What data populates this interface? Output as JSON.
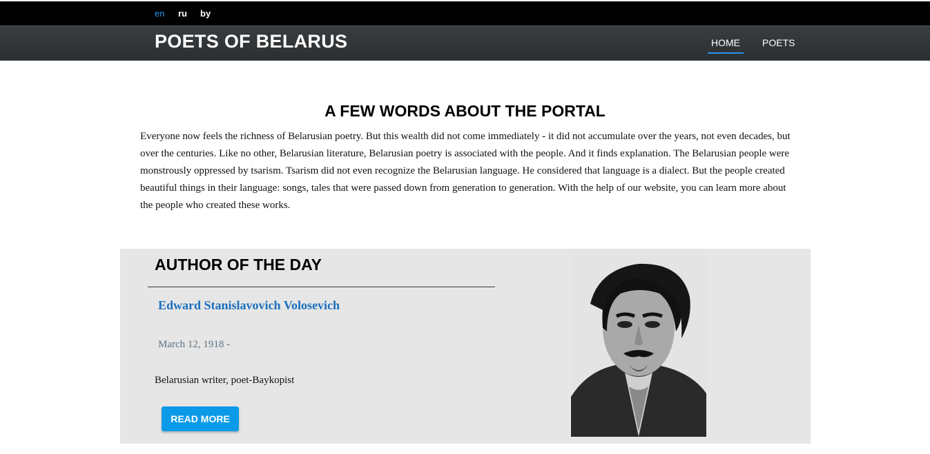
{
  "languages": [
    {
      "label": "en",
      "active": true
    },
    {
      "label": "ru",
      "active": false
    },
    {
      "label": "by",
      "active": false
    }
  ],
  "header": {
    "brand": "POETS OF BELARUS",
    "nav": [
      {
        "label": "HOME",
        "active": true
      },
      {
        "label": "POETS",
        "active": false
      }
    ]
  },
  "portal": {
    "title": "A FEW WORDS ABOUT THE PORTAL",
    "text": "Everyone now feels the richness of Belarusian poetry. But this wealth did not come immediately - it did not accumulate over the years, not even decades, but over the centuries. Like no other, Belarusian literature, Belarusian poetry is associated with the people. And it finds explanation. The Belarusian people were monstrously oppressed by tsarism. Tsarism did not even recognize the Belarusian language. He considered that language is a dialect. But the people created beautiful things in their language: songs, tales that were passed down from generation to generation. With the help of our website, you can learn more about the people who created these works."
  },
  "author_of_day": {
    "title": "AUTHOR OF THE DAY",
    "name": "Edward Stanislavovich Volosevich",
    "dates": "March 12, 1918 -",
    "description": "Belarusian writer, poet-Baykopist",
    "button_label": "READ MORE"
  },
  "colors": {
    "accent": "#2196f3",
    "link": "#1a6fbd",
    "button": "#0b9ae8",
    "panel": "#e6e6e6"
  }
}
